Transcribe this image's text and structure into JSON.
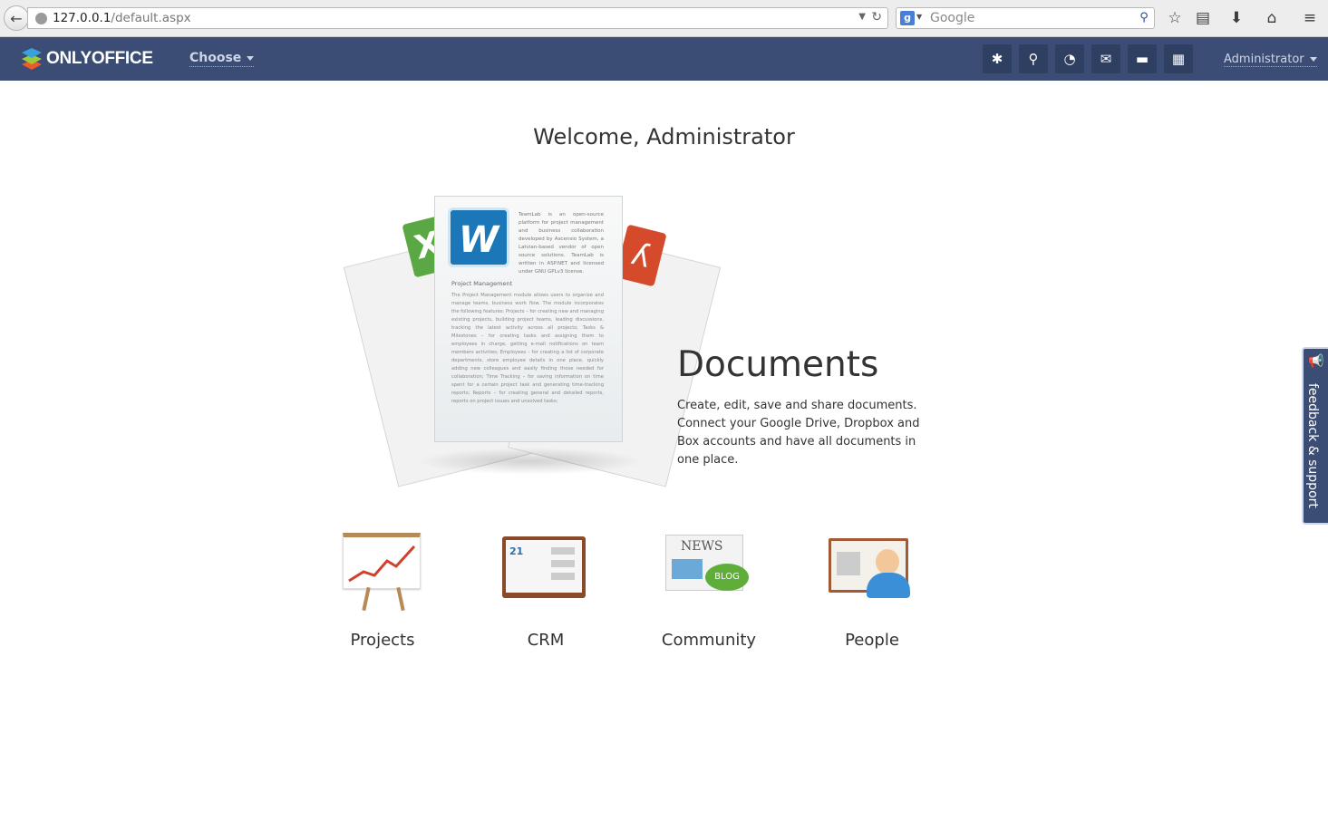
{
  "browser": {
    "url_host": "127.0.0.1",
    "url_path": "/default.aspx",
    "search_placeholder": "Google"
  },
  "header": {
    "logo_text": "ONLYOFFICE",
    "choose_label": "Choose",
    "user_label": "Administrator",
    "buttons": [
      "gear-icon",
      "search-icon",
      "feed-icon",
      "mail-icon",
      "chat-icon",
      "calendar-icon"
    ],
    "background": "#3b4d74"
  },
  "main": {
    "welcome": "Welcome, Administrator",
    "documents": {
      "title": "Documents",
      "description": "Create, edit, save and share documents. Connect your Google Drive, Dropbox and Box accounts and have all documents in one place.",
      "sheet_intro": "TeamLab is an open-source platform for project management and business collaboration developed by Ascensio System, a Latvian-based vendor of open source solutions. TeamLab is written in ASP.NET and licensed under GNU GPLv3 license.",
      "sheet_heading": "Project Management",
      "sheet_body": "The Project Management module allows users to organize and manage teams, business work flow. The module incorporates the following features: Projects – for creating new and managing existing projects, building project teams, leading discussions, tracking the latest activity across all projects; Tasks & Milestones – for creating tasks and assigning them to employees in charge, getting e-mail notifications on team members activities; Employees – for creating a list of corporate departments, store employee details in one place, quickly adding new colleagues and easily finding those needed for collaboration; Time Tracking – for saving information on time spent for a certain project task and generating time-tracking reports; Reports – for creating general and detailed reports, reports on project issues and unsolved tasks;"
    },
    "modules": [
      {
        "label": "Projects"
      },
      {
        "label": "CRM"
      },
      {
        "label": "Community"
      },
      {
        "label": "People"
      }
    ],
    "icon_text": {
      "calendar_day": "21",
      "news": "NEWS",
      "blog": "BLOG"
    }
  },
  "feedback": {
    "label": "feedback & support"
  }
}
